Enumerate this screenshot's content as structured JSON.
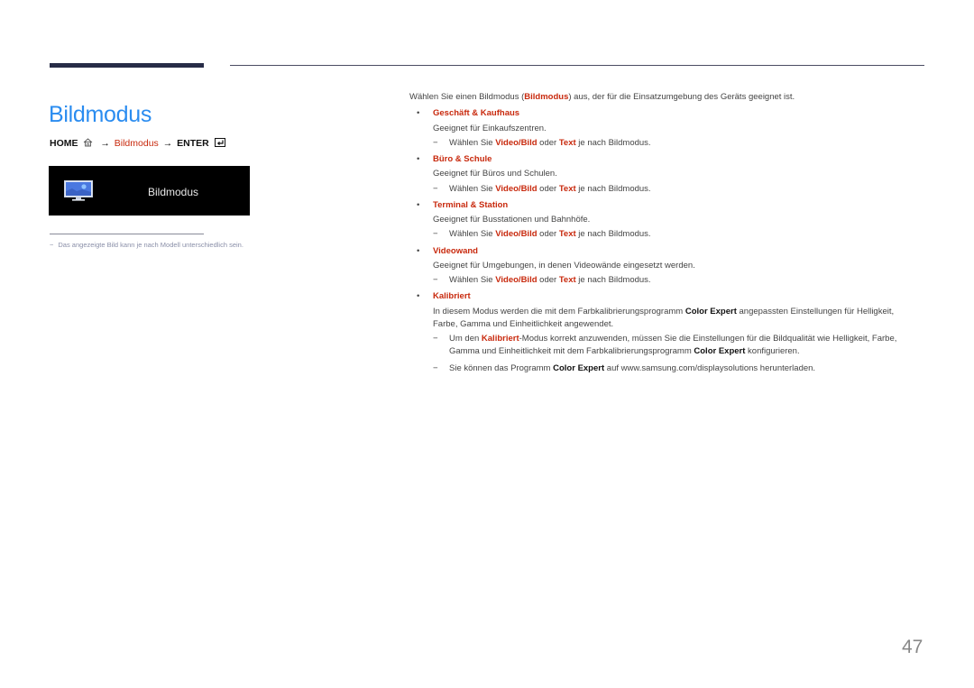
{
  "header": {
    "title": "Bildmodus"
  },
  "nav_path": {
    "home": "HOME",
    "arrow1": "→",
    "menu": "Bildmodus",
    "arrow2": "→",
    "enter": "ENTER",
    "icons": [
      "home-icon",
      "enter-icon"
    ]
  },
  "osd": {
    "icon": "picture-monitor-icon",
    "label": "Bildmodus"
  },
  "footnote": {
    "dash": "−",
    "text": "Das angezeigte Bild kann je nach Modell unterschiedlich sein."
  },
  "main": {
    "intro_before": "Wählen Sie einen Bildmodus (",
    "intro_bold": "Bildmodus",
    "intro_after": ") aus, der für die Einsatzumgebung des Geräts geeignet ist.",
    "bullet": "•",
    "dash": "−",
    "items": [
      {
        "title": "Geschäft & Kaufhaus",
        "desc": "Geeignet für Einkaufszentren.",
        "note": {
          "before": "Wählen Sie ",
          "b1": "Video/Bild",
          "mid": " oder ",
          "b2": "Text",
          "after": " je nach Bildmodus."
        }
      },
      {
        "title": "Büro & Schule",
        "desc": "Geeignet für Büros und Schulen.",
        "note": {
          "before": "Wählen Sie ",
          "b1": "Video/Bild",
          "mid": " oder ",
          "b2": "Text",
          "after": " je nach Bildmodus."
        }
      },
      {
        "title": "Terminal & Station",
        "desc": "Geeignet für Busstationen und Bahnhöfe.",
        "note": {
          "before": "Wählen Sie ",
          "b1": "Video/Bild",
          "mid": " oder ",
          "b2": "Text",
          "after": " je nach Bildmodus."
        }
      },
      {
        "title": "Videowand",
        "desc": "Geeignet für Umgebungen, in denen Videowände eingesetzt werden.",
        "note": {
          "before": "Wählen Sie ",
          "b1": "Video/Bild",
          "mid": " oder ",
          "b2": "Text",
          "after": " je nach Bildmodus."
        }
      }
    ],
    "calibrated": {
      "title": "Kalibriert",
      "desc_before": "In diesem Modus werden die mit dem Farbkalibrierungsprogramm ",
      "desc_bold": "Color Expert",
      "desc_after": " angepassten Einstellungen für Helligkeit, Farbe, Gamma und Einheitlichkeit angewendet.",
      "note1_before": "Um den ",
      "note1_red": "Kalibriert",
      "note1_mid": "-Modus korrekt anzuwenden, müssen Sie die Einstellungen für die Bildqualität wie Helligkeit, Farbe, Gamma und Einheitlichkeit mit dem Farbkalibrierungsprogramm ",
      "note1_bold": "Color Expert",
      "note1_after": " konfigurieren.",
      "note2_before": "Sie können das Programm ",
      "note2_bold": "Color Expert",
      "note2_after": " auf www.samsung.com/displaysolutions herunterladen."
    }
  },
  "page_number": "47",
  "colors": {
    "title_blue": "#2a8cf0",
    "highlight_red": "#c8290d",
    "rule_navy": "#272c47"
  }
}
